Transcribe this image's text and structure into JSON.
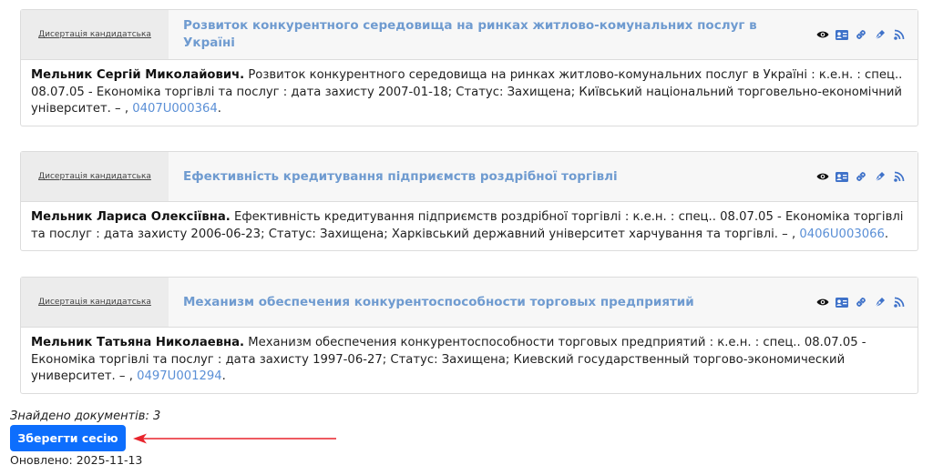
{
  "records": [
    {
      "type_label": "Дисертація кандидатська",
      "title": "Розвиток конкурентного середовища на ринках житлово-комунальних послуг в Україні",
      "author": "Мельник Сергій Миколайович.",
      "description": " Розвиток конкурентного середовища на ринках житлово-комунальних послуг в Україні : к.е.н. : спец.. 08.07.05 - Економіка торгівлі та послуг : дата захисту 2007-01-18; Статус: Захищена; Київський національний торговельно-економічний університет. – , ",
      "doc_id": "0407U000364",
      "end": "."
    },
    {
      "type_label": "Дисертація кандидатська",
      "title": "Ефективність кредитування підприємств роздрібної торгівлі",
      "author": "Мельник Лариса Олексіївна.",
      "description": " Ефективність кредитування підприємств роздрібної торгівлі : к.е.н. : спец.. 08.07.05 - Економіка торгівлі та послуг : дата захисту 2006-06-23; Статус: Захищена; Харківський державний університет харчування та торгівлі. – , ",
      "doc_id": "0406U003066",
      "end": "."
    },
    {
      "type_label": "Дисертація кандидатська",
      "title": "Механизм обеспечения конкурентоспособности торговых предприятий",
      "author": "Мельник Татьяна Николаевна.",
      "description": " Механизм обеспечения конкурентоспособности торговых предприятий : к.е.н. : спец.. 08.07.05 - Економіка торгівлі та послуг : дата захисту 1997-06-27; Статус: Захищена; Киевский государственный торгово-экономический университет. – , ",
      "doc_id": "0497U001294",
      "end": "."
    }
  ],
  "icons": [
    "eye-icon",
    "id-card-icon",
    "link-icon",
    "pen-icon",
    "feed-icon"
  ],
  "footer": {
    "found_label": "Знайдено документів: 3",
    "save_button": "Зберегти сесію",
    "updated": "Оновлено: 2025-11-13"
  },
  "colors": {
    "title": "#6f9bd0",
    "link": "#5a8fd6",
    "icon": "#3f72c9",
    "button": "#0d6efd",
    "arrow": "#e8242c"
  }
}
